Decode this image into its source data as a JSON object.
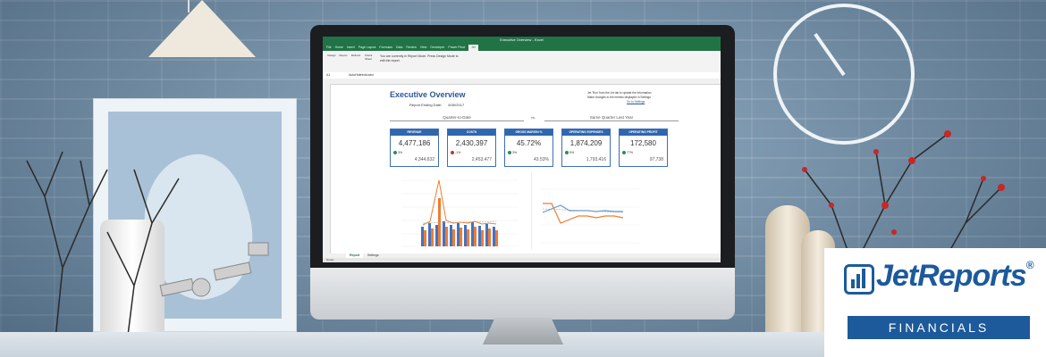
{
  "excel": {
    "window_title": "Executive Overview - Excel",
    "tabs": [
      "File",
      "Home",
      "Insert",
      "Page Layout",
      "Formulas",
      "Data",
      "Review",
      "View",
      "Developer",
      "Power Pivot",
      "Jet"
    ],
    "active_tab": "Jet",
    "ribbon_buttons": [
      "Design",
      "Report",
      "Refresh",
      "Check Sheet"
    ],
    "ribbon_note": "You are currently in Report Mode. Press Design Mode to edit the report.",
    "cell_ref": "A1",
    "formula": "AutoHideIndicator",
    "title": "Executive Overview",
    "report_ending_label": "Report Ending Date:",
    "report_ending_value": "8/30/2017",
    "right_note_1": "Jet 'Run' from the Jet tab to update the information.",
    "right_note_2": "Make changes to the metrics displayed in Settings",
    "settings_link": "Go to Settings",
    "section_left": "Quarter-to-Date",
    "vs": "vs.",
    "section_right": "Same Quarter Last Year",
    "cards": [
      {
        "header": "REVENUE",
        "value": "4,477,186",
        "delta": "3%",
        "delta_color": "#2e8b57",
        "prior": "4,344,632"
      },
      {
        "header": "COSTS",
        "value": "2,430,397",
        "delta": "-1%",
        "delta_color": "#c0392b",
        "prior": "2,453,477"
      },
      {
        "header": "GROSS MARGIN %",
        "value": "45.72%",
        "delta": "3%",
        "delta_color": "#2e8b57",
        "prior": "43.53%"
      },
      {
        "header": "OPERATING EXPENSES",
        "value": "1,874,209",
        "delta": "5%",
        "delta_color": "#2e8b57",
        "prior": "1,793,416"
      },
      {
        "header": "OPERATING PROFIT",
        "value": "172,580",
        "delta": "77%",
        "delta_color": "#2e8b57",
        "prior": "97,738"
      }
    ],
    "sheet_tabs": [
      "Report",
      "Settings"
    ],
    "active_sheet": "Report",
    "status_text": "Ready"
  },
  "logo": {
    "name": "JetReports",
    "registered": "®",
    "subtitle": "FINANCIALS",
    "brand_color": "#1d5a9b"
  },
  "colors": {
    "excel_green": "#217346",
    "card_blue": "#2f66b0"
  }
}
